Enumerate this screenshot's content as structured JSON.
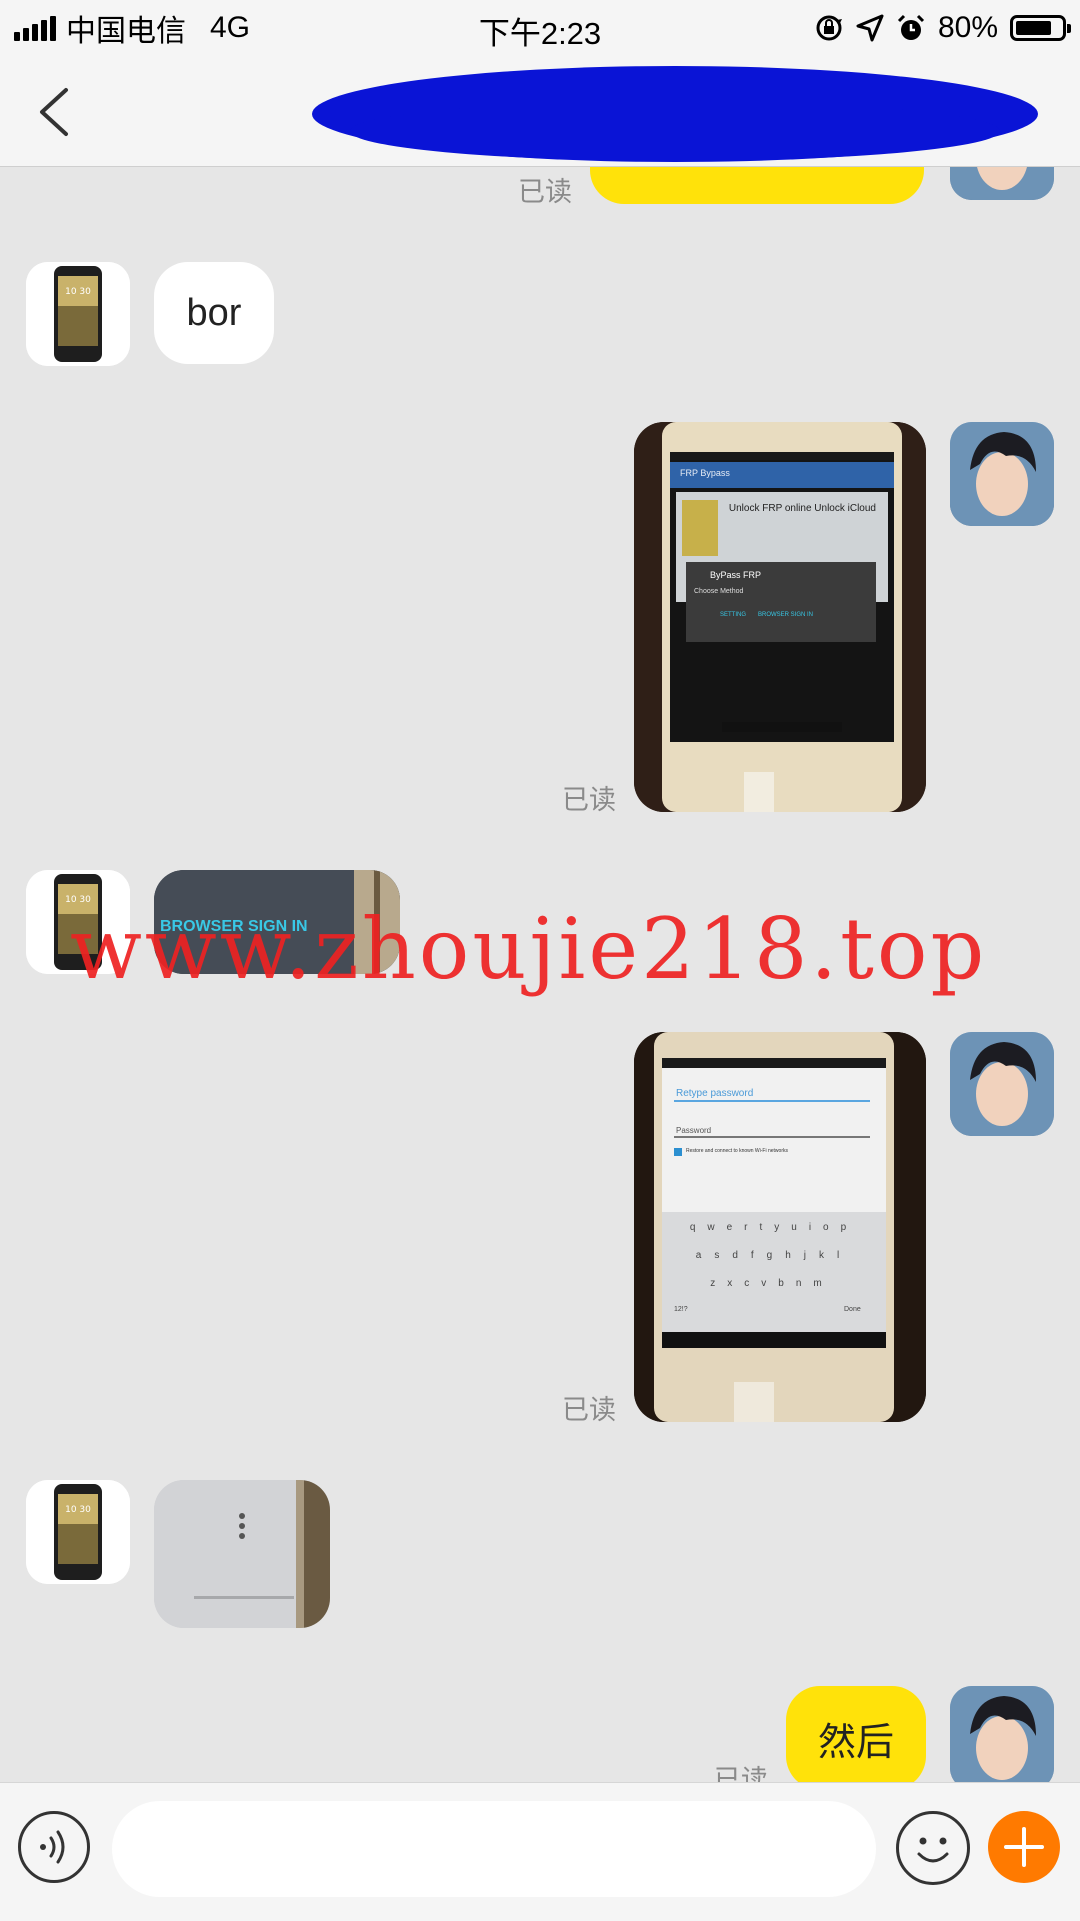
{
  "status_bar": {
    "carrier": "中国电信",
    "network": "4G",
    "time": "下午2:23",
    "battery": "80%",
    "battery_level": 0.8,
    "icons": [
      "signal-icon",
      "orientation-lock-icon",
      "location-icon",
      "alarm-icon",
      "battery-icon"
    ]
  },
  "nav": {
    "back_icon": "chevron-left-icon",
    "title_redacted_color": "#0a14d6"
  },
  "messages": [
    {
      "side": "right",
      "type": "text",
      "text": "",
      "read": "已读",
      "color": "#ffe20a"
    },
    {
      "side": "left",
      "type": "text",
      "text": "bor"
    },
    {
      "side": "right",
      "type": "image",
      "read": "已读",
      "image": {
        "title": "FRP Bypass",
        "card_text": "Unlock FRP online Unlock iCloud",
        "dialog_title": "ByPass FRP",
        "dialog_body": "Choose Method",
        "btn_setting": "SETTING",
        "btn_browser": "BROWSER SIGN IN"
      }
    },
    {
      "side": "left",
      "type": "image",
      "caption": "BROWSER SIGN IN"
    },
    {
      "side": "right",
      "type": "image",
      "read": "已读",
      "image": {
        "retype_label": "Retype password",
        "password_label": "Password",
        "checkbox_text": "Restore and connect to known Wi-Fi networks",
        "keyboard_rows": [
          "qwertyuiop",
          "asdfghjkl",
          "zxcvbnm"
        ],
        "key_num": "12!?",
        "key_done": "Done"
      }
    },
    {
      "side": "left",
      "type": "image",
      "caption": ""
    },
    {
      "side": "right",
      "type": "text",
      "text": "然后",
      "read": "已读",
      "color": "#ffe20a"
    }
  ],
  "watermark": "www.zhoujie218.top",
  "input_bar": {
    "placeholder": "",
    "voice_icon": "voice-icon",
    "emoji_icon": "emoji-icon",
    "plus_icon": "plus-icon",
    "accent": "#ff7a00"
  }
}
